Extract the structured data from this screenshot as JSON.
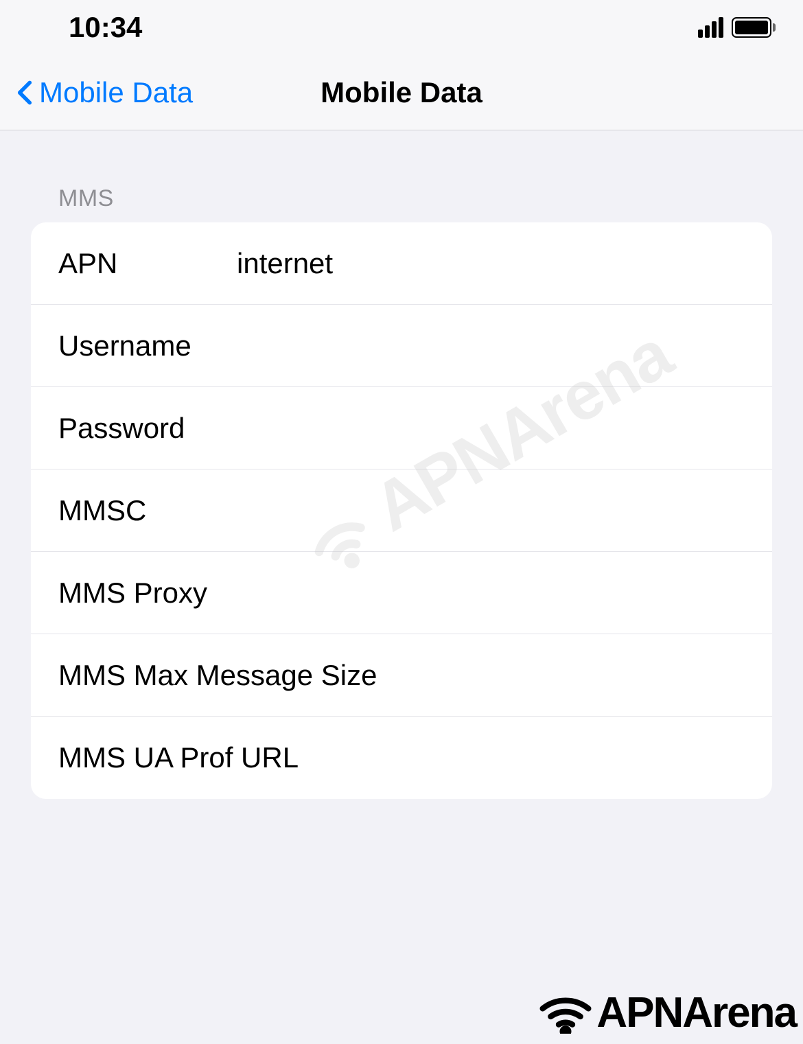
{
  "status_bar": {
    "time": "10:34"
  },
  "nav": {
    "back_label": "Mobile Data",
    "title": "Mobile Data"
  },
  "section": {
    "header": "MMS",
    "rows": [
      {
        "label": "APN",
        "value": "internet"
      },
      {
        "label": "Username",
        "value": ""
      },
      {
        "label": "Password",
        "value": ""
      },
      {
        "label": "MMSC",
        "value": ""
      },
      {
        "label": "MMS Proxy",
        "value": ""
      },
      {
        "label": "MMS Max Message Size",
        "value": ""
      },
      {
        "label": "MMS UA Prof URL",
        "value": ""
      }
    ]
  },
  "watermark": {
    "text": "APNArena"
  }
}
